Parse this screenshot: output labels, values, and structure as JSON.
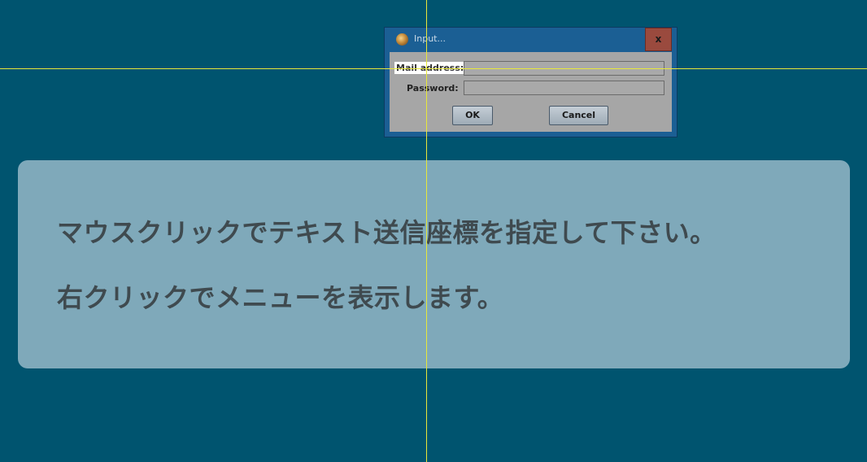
{
  "dialog": {
    "title": "Input...",
    "close_label": "x",
    "mail_label": "Mail address:",
    "mail_value": "",
    "password_label": "Password:",
    "password_value": "",
    "ok_label": "OK",
    "cancel_label": "Cancel"
  },
  "overlay": {
    "line1": "マウスクリックでテキスト送信座標を指定して下さい。",
    "line2": "右クリックでメニューを表示します。"
  },
  "colors": {
    "background": "#00546f",
    "panel": "#7fa9ba",
    "crosshair": "#e8e83a",
    "dialog_frame": "#1b5f94",
    "close_button": "#9a4a3e"
  },
  "icons": {
    "dialog_icon": "app-icon",
    "close_icon": "close-icon"
  }
}
